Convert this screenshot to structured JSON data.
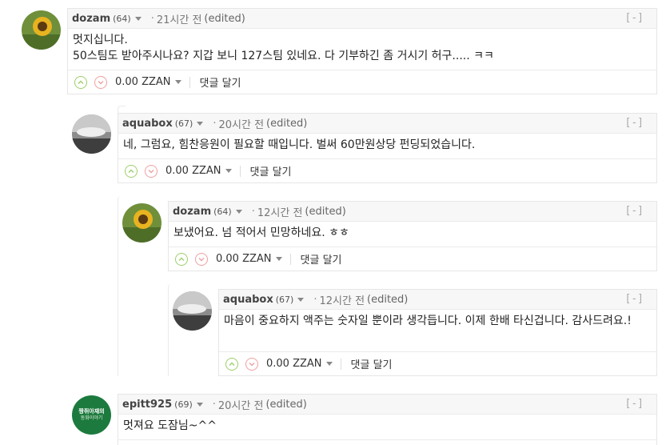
{
  "comments": [
    {
      "author": "dozam",
      "rep": "(64)",
      "dot": "·",
      "time": "21시간 전",
      "edited": "(edited)",
      "collapse": "[-]",
      "body": [
        "멋지십니다.",
        "50스팀도 받아주시나요? 지갑 보니 127스팀 있네요. 다 기부하긴 좀 거시기 허구..... ㅋㅋ"
      ],
      "payout": "0.00 ZZAN",
      "reply": "댓글 달기",
      "avatar": "sunflower"
    },
    {
      "author": "aquabox",
      "rep": "(67)",
      "dot": "·",
      "time": "20시간 전",
      "edited": "(edited)",
      "collapse": "[-]",
      "body": [
        "네, 그럼요, 힘찬응원이 필요할 때입니다. 벌써 60만원상당 펀딩되었습니다."
      ],
      "payout": "0.00 ZZAN",
      "reply": "댓글 달기",
      "avatar": "landscape"
    },
    {
      "author": "dozam",
      "rep": "(64)",
      "dot": "·",
      "time": "12시간 전",
      "edited": "(edited)",
      "collapse": "[-]",
      "body": [
        "보냈어요. 넘 적어서 민망하네요. ㅎㅎ"
      ],
      "payout": "0.00 ZZAN",
      "reply": "댓글 달기",
      "avatar": "sunflower"
    },
    {
      "author": "aquabox",
      "rep": "(67)",
      "dot": "·",
      "time": "12시간 전",
      "edited": "(edited)",
      "collapse": "[-]",
      "body": [
        "마음이 중요하지 액주는 숫자일 뿐이라 생각듭니다. 이제 한배 타신겁니다. 감사드려요.!"
      ],
      "payout": "0.00 ZZAN",
      "reply": "댓글 달기",
      "avatar": "landscape"
    },
    {
      "author": "epitt925",
      "rep": "(69)",
      "dot": "·",
      "time": "20시간 전",
      "edited": "(edited)",
      "collapse": "[-]",
      "body": [
        "멋져요 도잠님~^^"
      ],
      "payout": "",
      "reply": "",
      "avatar": "logo",
      "avatar_text": [
        "짱쥐아재의",
        "동화이야기"
      ]
    }
  ],
  "colors": {
    "upvote": "#9dcf6a",
    "downvote": "#f0a0a0",
    "logo_bg": "#1d7a3e"
  }
}
